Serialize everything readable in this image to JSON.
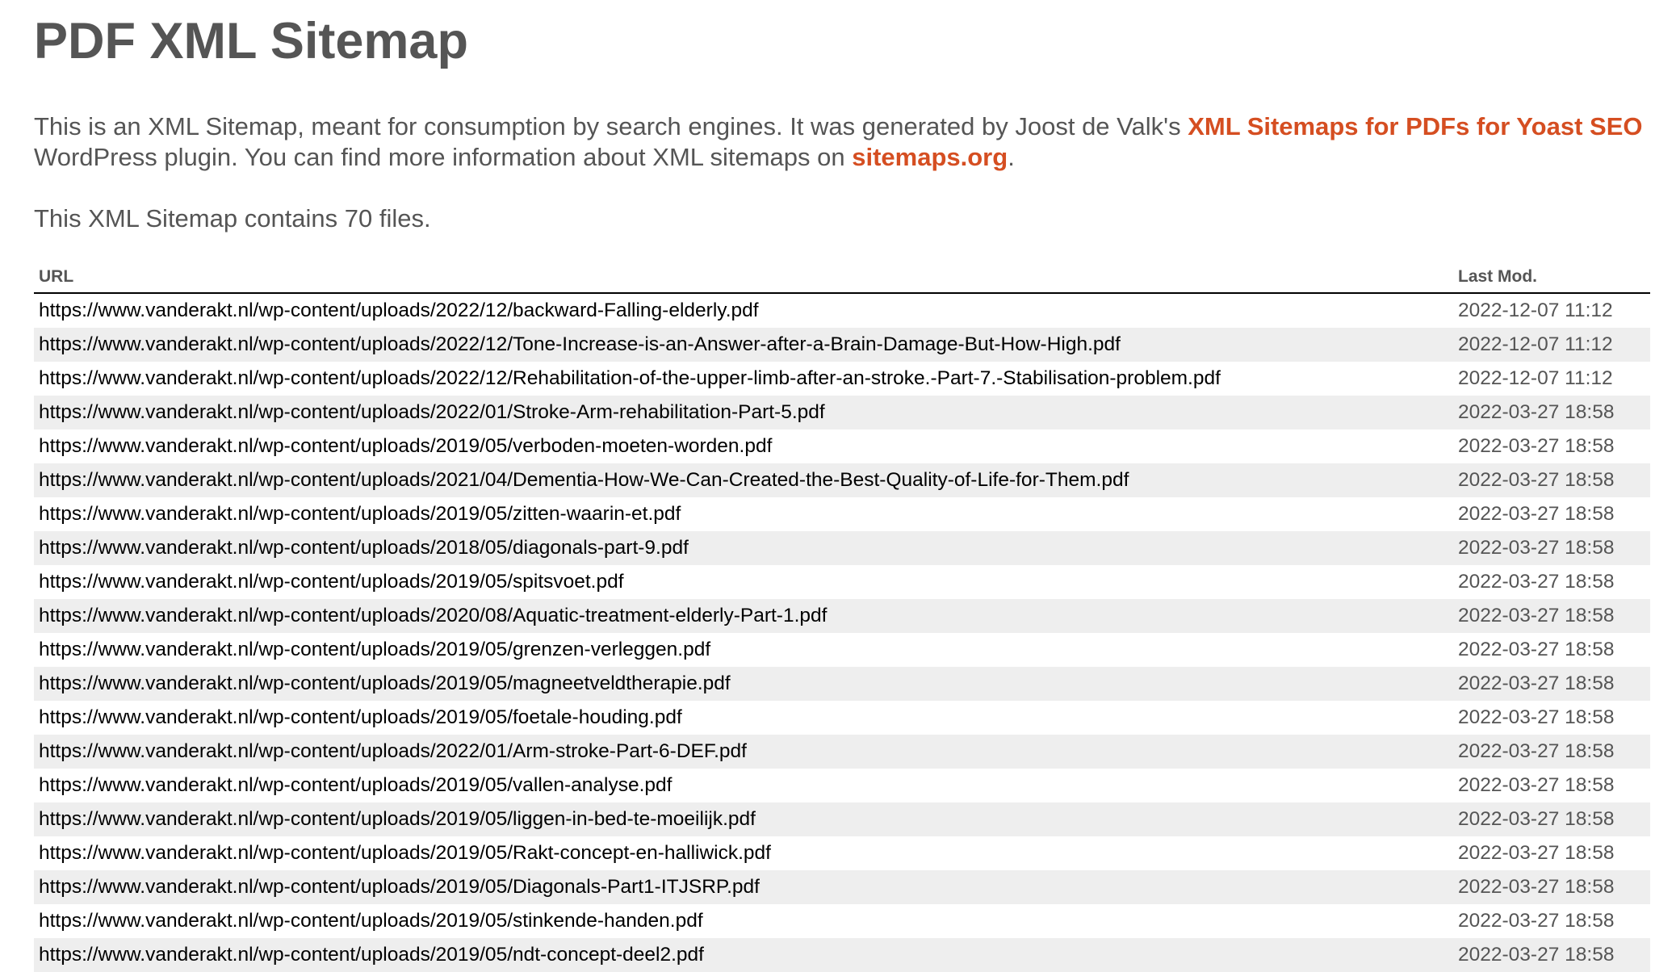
{
  "title": "PDF XML Sitemap",
  "intro": {
    "text_before": "This is an XML Sitemap, meant for consumption by search engines. It was generated by Joost de Valk's ",
    "plugin_link": "XML Sitemaps for PDFs for Yoast SEO",
    "text_middle": " WordPress plugin. You can find more information about XML sitemaps on ",
    "sitemaps_link": "sitemaps.org",
    "text_after": "."
  },
  "count_text": "This XML Sitemap contains 70 files.",
  "table": {
    "headers": {
      "url": "URL",
      "last_mod": "Last Mod."
    },
    "rows": [
      {
        "url": "https://www.vanderakt.nl/wp-content/uploads/2022/12/backward-Falling-elderly.pdf",
        "last_mod": "2022-12-07 11:12"
      },
      {
        "url": "https://www.vanderakt.nl/wp-content/uploads/2022/12/Tone-Increase-is-an-Answer-after-a-Brain-Damage-But-How-High.pdf",
        "last_mod": "2022-12-07 11:12"
      },
      {
        "url": "https://www.vanderakt.nl/wp-content/uploads/2022/12/Rehabilitation-of-the-upper-limb-after-an-stroke.-Part-7.-Stabilisation-problem.pdf",
        "last_mod": "2022-12-07 11:12"
      },
      {
        "url": "https://www.vanderakt.nl/wp-content/uploads/2022/01/Stroke-Arm-rehabilitation-Part-5.pdf",
        "last_mod": "2022-03-27 18:58"
      },
      {
        "url": "https://www.vanderakt.nl/wp-content/uploads/2019/05/verboden-moeten-worden.pdf",
        "last_mod": "2022-03-27 18:58"
      },
      {
        "url": "https://www.vanderakt.nl/wp-content/uploads/2021/04/Dementia-How-We-Can-Created-the-Best-Quality-of-Life-for-Them.pdf",
        "last_mod": "2022-03-27 18:58"
      },
      {
        "url": "https://www.vanderakt.nl/wp-content/uploads/2019/05/zitten-waarin-et.pdf",
        "last_mod": "2022-03-27 18:58"
      },
      {
        "url": "https://www.vanderakt.nl/wp-content/uploads/2018/05/diagonals-part-9.pdf",
        "last_mod": "2022-03-27 18:58"
      },
      {
        "url": "https://www.vanderakt.nl/wp-content/uploads/2019/05/spitsvoet.pdf",
        "last_mod": "2022-03-27 18:58"
      },
      {
        "url": "https://www.vanderakt.nl/wp-content/uploads/2020/08/Aquatic-treatment-elderly-Part-1.pdf",
        "last_mod": "2022-03-27 18:58"
      },
      {
        "url": "https://www.vanderakt.nl/wp-content/uploads/2019/05/grenzen-verleggen.pdf",
        "last_mod": "2022-03-27 18:58"
      },
      {
        "url": "https://www.vanderakt.nl/wp-content/uploads/2019/05/magneetveldtherapie.pdf",
        "last_mod": "2022-03-27 18:58"
      },
      {
        "url": "https://www.vanderakt.nl/wp-content/uploads/2019/05/foetale-houding.pdf",
        "last_mod": "2022-03-27 18:58"
      },
      {
        "url": "https://www.vanderakt.nl/wp-content/uploads/2022/01/Arm-stroke-Part-6-DEF.pdf",
        "last_mod": "2022-03-27 18:58"
      },
      {
        "url": "https://www.vanderakt.nl/wp-content/uploads/2019/05/vallen-analyse.pdf",
        "last_mod": "2022-03-27 18:58"
      },
      {
        "url": "https://www.vanderakt.nl/wp-content/uploads/2019/05/liggen-in-bed-te-moeilijk.pdf",
        "last_mod": "2022-03-27 18:58"
      },
      {
        "url": "https://www.vanderakt.nl/wp-content/uploads/2019/05/Rakt-concept-en-halliwick.pdf",
        "last_mod": "2022-03-27 18:58"
      },
      {
        "url": "https://www.vanderakt.nl/wp-content/uploads/2019/05/Diagonals-Part1-ITJSRP.pdf",
        "last_mod": "2022-03-27 18:58"
      },
      {
        "url": "https://www.vanderakt.nl/wp-content/uploads/2019/05/stinkende-handen.pdf",
        "last_mod": "2022-03-27 18:58"
      },
      {
        "url": "https://www.vanderakt.nl/wp-content/uploads/2019/05/ndt-concept-deel2.pdf",
        "last_mod": "2022-03-27 18:58"
      }
    ]
  }
}
